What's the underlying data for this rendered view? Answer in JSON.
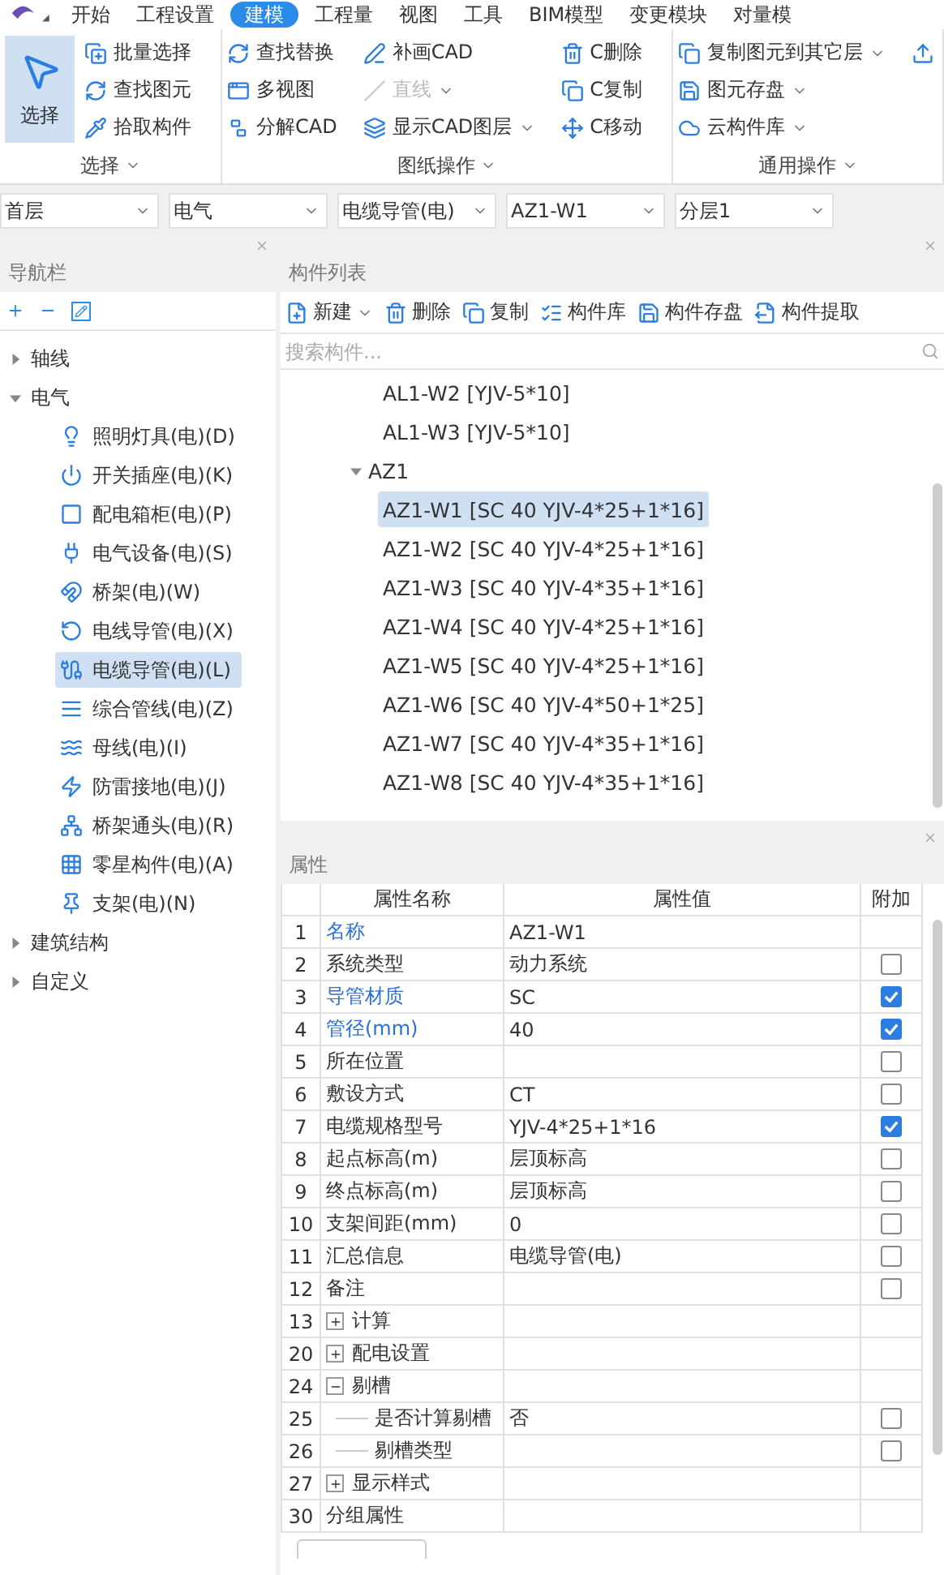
{
  "ribbon": {
    "tabs": [
      {
        "label": "开始",
        "selected": false
      },
      {
        "label": "工程设置",
        "selected": false
      },
      {
        "label": "建模",
        "selected": true
      },
      {
        "label": "工程量",
        "selected": false
      },
      {
        "label": "视图",
        "selected": false
      },
      {
        "label": "工具",
        "selected": false
      },
      {
        "label": "BIM模型",
        "selected": false
      },
      {
        "label": "变更模块",
        "selected": false
      },
      {
        "label": "对量模",
        "selected": false
      }
    ],
    "groups": [
      {
        "label": "选择",
        "large": {
          "label": "选择",
          "selected": true
        },
        "columns": [
          [
            {
              "label": "批量选择",
              "disabled": false,
              "dropdown": false
            },
            {
              "label": "查找图元",
              "disabled": false,
              "dropdown": false
            },
            {
              "label": "拾取构件",
              "disabled": false,
              "dropdown": false
            }
          ]
        ]
      },
      {
        "label": "图纸操作",
        "columns": [
          [
            {
              "label": "查找替换",
              "disabled": false,
              "dropdown": false
            },
            {
              "label": "多视图",
              "disabled": false,
              "dropdown": false
            },
            {
              "label": "分解CAD",
              "disabled": false,
              "dropdown": false
            }
          ],
          [
            {
              "label": "补画CAD",
              "disabled": false,
              "dropdown": false
            },
            {
              "label": "直线",
              "disabled": true,
              "dropdown": true
            },
            {
              "label": "显示CAD图层",
              "disabled": false,
              "dropdown": true
            }
          ],
          [
            {
              "label": "C删除",
              "disabled": false,
              "dropdown": false
            },
            {
              "label": "C复制",
              "disabled": false,
              "dropdown": false
            },
            {
              "label": "C移动",
              "disabled": false,
              "dropdown": false
            }
          ]
        ]
      },
      {
        "label": "通用操作",
        "columns": [
          [
            {
              "label": "复制图元到其它层",
              "disabled": false,
              "dropdown": true
            },
            {
              "label": "图元存盘",
              "disabled": false,
              "dropdown": true
            },
            {
              "label": "云构件库",
              "disabled": false,
              "dropdown": true
            }
          ]
        ]
      }
    ]
  },
  "selectors": [
    {
      "value": "首层"
    },
    {
      "value": "电气"
    },
    {
      "value": "电缆导管(电)"
    },
    {
      "value": "AZ1-W1"
    },
    {
      "value": "分层1"
    }
  ],
  "navigation": {
    "title": "导航栏",
    "tree": [
      {
        "label": "轴线",
        "expanded": false
      },
      {
        "label": "电气",
        "expanded": true,
        "children": [
          {
            "label": "照明灯具(电)(D)",
            "selected": false
          },
          {
            "label": "开关插座(电)(K)",
            "selected": false
          },
          {
            "label": "配电箱柜(电)(P)",
            "selected": false
          },
          {
            "label": "电气设备(电)(S)",
            "selected": false
          },
          {
            "label": "桥架(电)(W)",
            "selected": false
          },
          {
            "label": "电线导管(电)(X)",
            "selected": false
          },
          {
            "label": "电缆导管(电)(L)",
            "selected": true
          },
          {
            "label": "综合管线(电)(Z)",
            "selected": false
          },
          {
            "label": "母线(电)(I)",
            "selected": false
          },
          {
            "label": "防雷接地(电)(J)",
            "selected": false
          },
          {
            "label": "桥架通头(电)(R)",
            "selected": false
          },
          {
            "label": "零星构件(电)(A)",
            "selected": false
          },
          {
            "label": "支架(电)(N)",
            "selected": false
          }
        ]
      },
      {
        "label": "建筑结构",
        "expanded": false
      },
      {
        "label": "自定义",
        "expanded": false
      }
    ]
  },
  "component_list": {
    "title": "构件列表",
    "toolbar": [
      {
        "label": "新建",
        "dropdown": true
      },
      {
        "label": "删除",
        "dropdown": false
      },
      {
        "label": "复制",
        "dropdown": false
      },
      {
        "label": "构件库",
        "dropdown": false
      },
      {
        "label": "构件存盘",
        "dropdown": false
      },
      {
        "label": "构件提取",
        "dropdown": false
      }
    ],
    "search": {
      "placeholder": "搜索构件..."
    },
    "tree": [
      {
        "children": [
          {
            "label": "AL1-W2 [YJV-5*10]",
            "selected": false
          },
          {
            "label": "AL1-W3 [YJV-5*10]",
            "selected": false
          }
        ]
      },
      {
        "label": "AZ1",
        "expanded": true,
        "children": [
          {
            "label": "AZ1-W1 [SC 40 YJV-4*25+1*16]",
            "selected": true
          },
          {
            "label": "AZ1-W2 [SC 40 YJV-4*25+1*16]",
            "selected": false
          },
          {
            "label": "AZ1-W3 [SC 40 YJV-4*35+1*16]",
            "selected": false
          },
          {
            "label": "AZ1-W4 [SC 40 YJV-4*25+1*16]",
            "selected": false
          },
          {
            "label": "AZ1-W5 [SC 40 YJV-4*25+1*16]",
            "selected": false
          },
          {
            "label": "AZ1-W6 [SC 40 YJV-4*50+1*25]",
            "selected": false
          },
          {
            "label": "AZ1-W7 [SC 40 YJV-4*35+1*16]",
            "selected": false
          },
          {
            "label": "AZ1-W8 [SC 40 YJV-4*35+1*16]",
            "selected": false
          }
        ]
      }
    ]
  },
  "properties": {
    "title": "属性",
    "columns": [
      "属性名称",
      "属性值",
      "附加"
    ],
    "rows": [
      {
        "kind": "title",
        "number": "1",
        "name": "名称",
        "value": "AZ1-W1",
        "required": true
      },
      {
        "kind": "field",
        "number": "2",
        "name": "系统类型",
        "value": "动力系统",
        "required": false,
        "checked": false
      },
      {
        "kind": "field",
        "number": "3",
        "name": "导管材质",
        "value": "SC",
        "required": true,
        "checked": true
      },
      {
        "kind": "field",
        "number": "4",
        "name": "管径(mm)",
        "value": "40",
        "required": true,
        "checked": true
      },
      {
        "kind": "field",
        "number": "5",
        "name": "所在位置",
        "required": false,
        "checked": false
      },
      {
        "kind": "field",
        "number": "6",
        "name": "敷设方式",
        "value": "CT",
        "required": false,
        "checked": false
      },
      {
        "kind": "field",
        "number": "7",
        "name": "电缆规格型号",
        "value": "YJV-4*25+1*16",
        "required": false,
        "checked": true
      },
      {
        "kind": "field",
        "number": "8",
        "name": "起点标高(m)",
        "value": "层顶标高",
        "required": false,
        "checked": false
      },
      {
        "kind": "field",
        "number": "9",
        "name": "终点标高(m)",
        "value": "层顶标高",
        "required": false,
        "checked": false
      },
      {
        "kind": "field",
        "number": "10",
        "name": "支架间距(mm)",
        "value": "0",
        "required": false,
        "checked": false
      },
      {
        "kind": "field",
        "number": "11",
        "name": "汇总信息",
        "value": "电缆导管(电)",
        "required": false,
        "checked": false
      },
      {
        "kind": "field",
        "number": "12",
        "name": "备注",
        "required": false,
        "checked": false
      },
      {
        "kind": "group",
        "number": "13",
        "name": "计算",
        "expanded": false
      },
      {
        "kind": "group",
        "number": "20",
        "name": "配电设置",
        "expanded": false
      },
      {
        "kind": "group",
        "number": "24",
        "name": "剔槽",
        "expanded": true
      },
      {
        "kind": "sub",
        "number": "25",
        "name": "是否计算剔槽",
        "value": "否",
        "checked": false
      },
      {
        "kind": "sub",
        "number": "26",
        "name": "剔槽类型",
        "checked": false
      },
      {
        "kind": "group",
        "number": "27",
        "name": "显示样式",
        "expanded": false
      },
      {
        "kind": "field",
        "number": "30",
        "name": "分组属性",
        "required": false
      }
    ]
  }
}
